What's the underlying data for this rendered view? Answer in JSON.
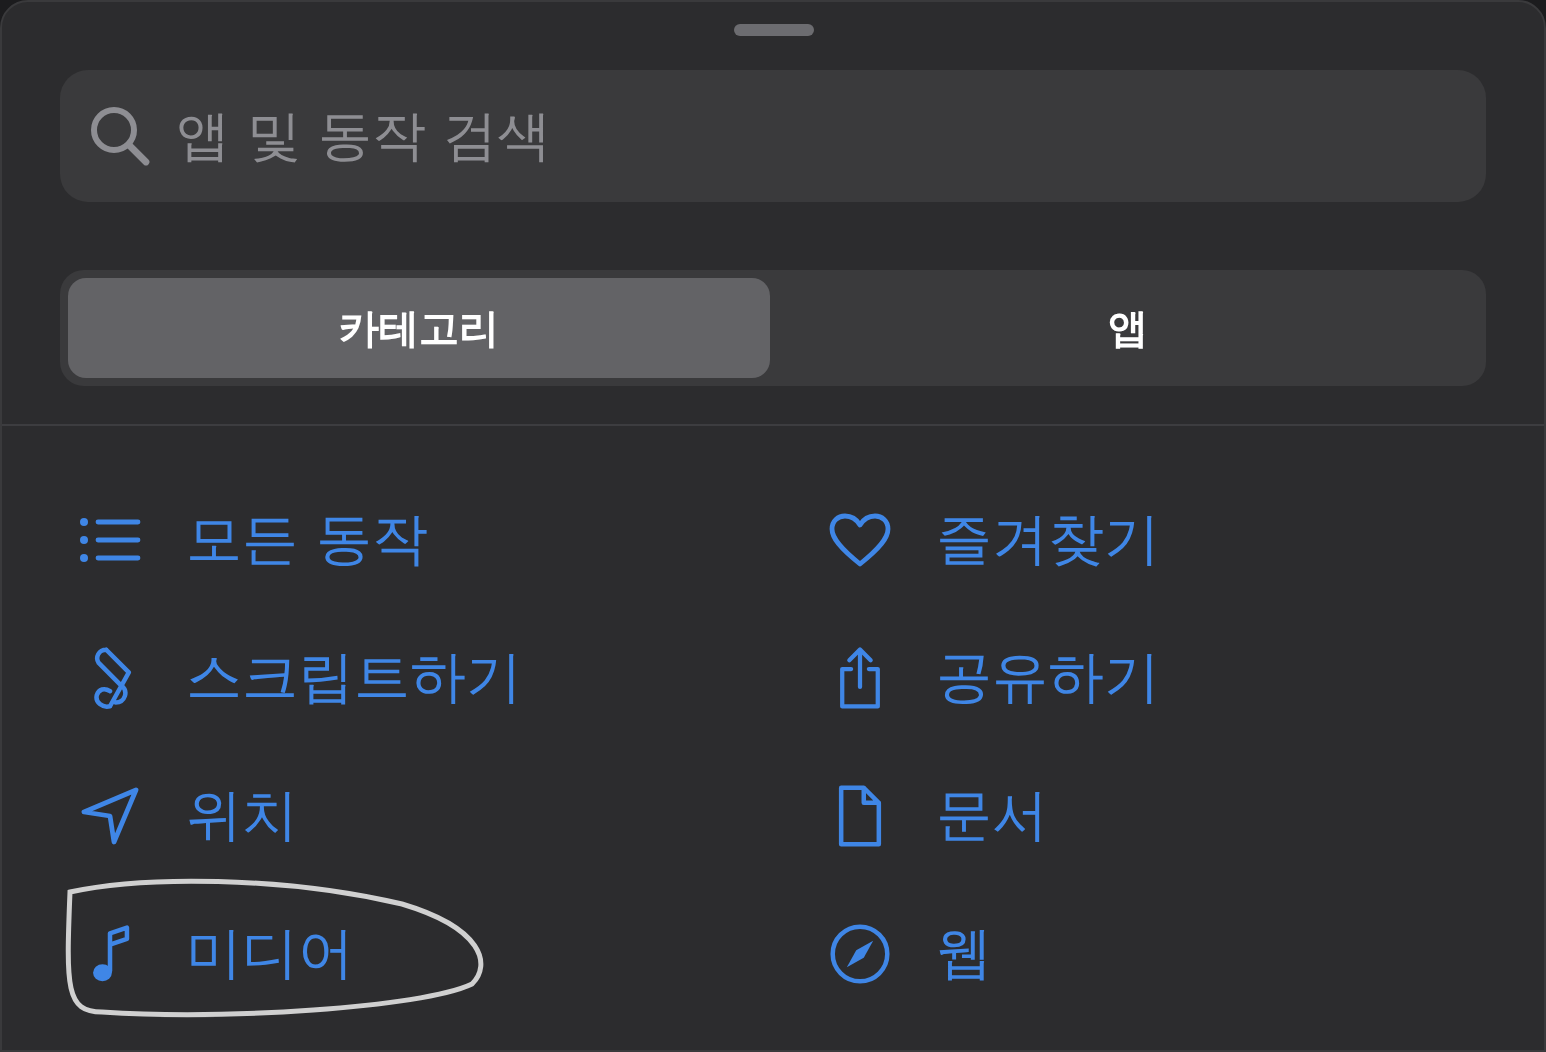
{
  "search": {
    "placeholder": "앱 및 동작 검색"
  },
  "tabs": [
    {
      "label": "카테고리",
      "selected": true
    },
    {
      "label": "앱",
      "selected": false
    }
  ],
  "categories": [
    {
      "label": "모든 동작",
      "kind": "list",
      "circled": false
    },
    {
      "label": "즐겨찾기",
      "kind": "heart",
      "circled": false
    },
    {
      "label": "스크립트하기",
      "kind": "script",
      "circled": false
    },
    {
      "label": "공유하기",
      "kind": "share",
      "circled": false
    },
    {
      "label": "위치",
      "kind": "location",
      "circled": false
    },
    {
      "label": "문서",
      "kind": "document",
      "circled": false
    },
    {
      "label": "미디어",
      "kind": "music",
      "circled": true
    },
    {
      "label": "웹",
      "kind": "compass",
      "circled": false
    }
  ]
}
